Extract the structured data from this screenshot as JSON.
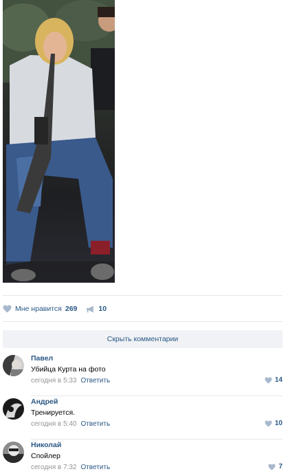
{
  "post": {
    "photo_alt": "",
    "actions": {
      "like_label": "Мне нравится",
      "like_count": "269",
      "share_count": "10"
    },
    "hide_comments_label": "Скрыть комментарии"
  },
  "comments": [
    {
      "author": "Павел",
      "text": "Убийца Курта на фото",
      "time": "сегодня в 5:33",
      "reply_label": "Ответить",
      "likes": "14"
    },
    {
      "author": "Андрей",
      "text": "Тренируется.",
      "time": "сегодня в 5:40",
      "reply_label": "Ответить",
      "likes": "10"
    },
    {
      "author": "Николай",
      "text": "Спойлер",
      "time": "сегодня в 7:32",
      "reply_label": "Ответить",
      "likes": "7"
    }
  ],
  "colors": {
    "link": "#2a5885",
    "meta": "#939393",
    "divider": "#e7e8ec",
    "hide_bg": "#f0f2f5"
  }
}
